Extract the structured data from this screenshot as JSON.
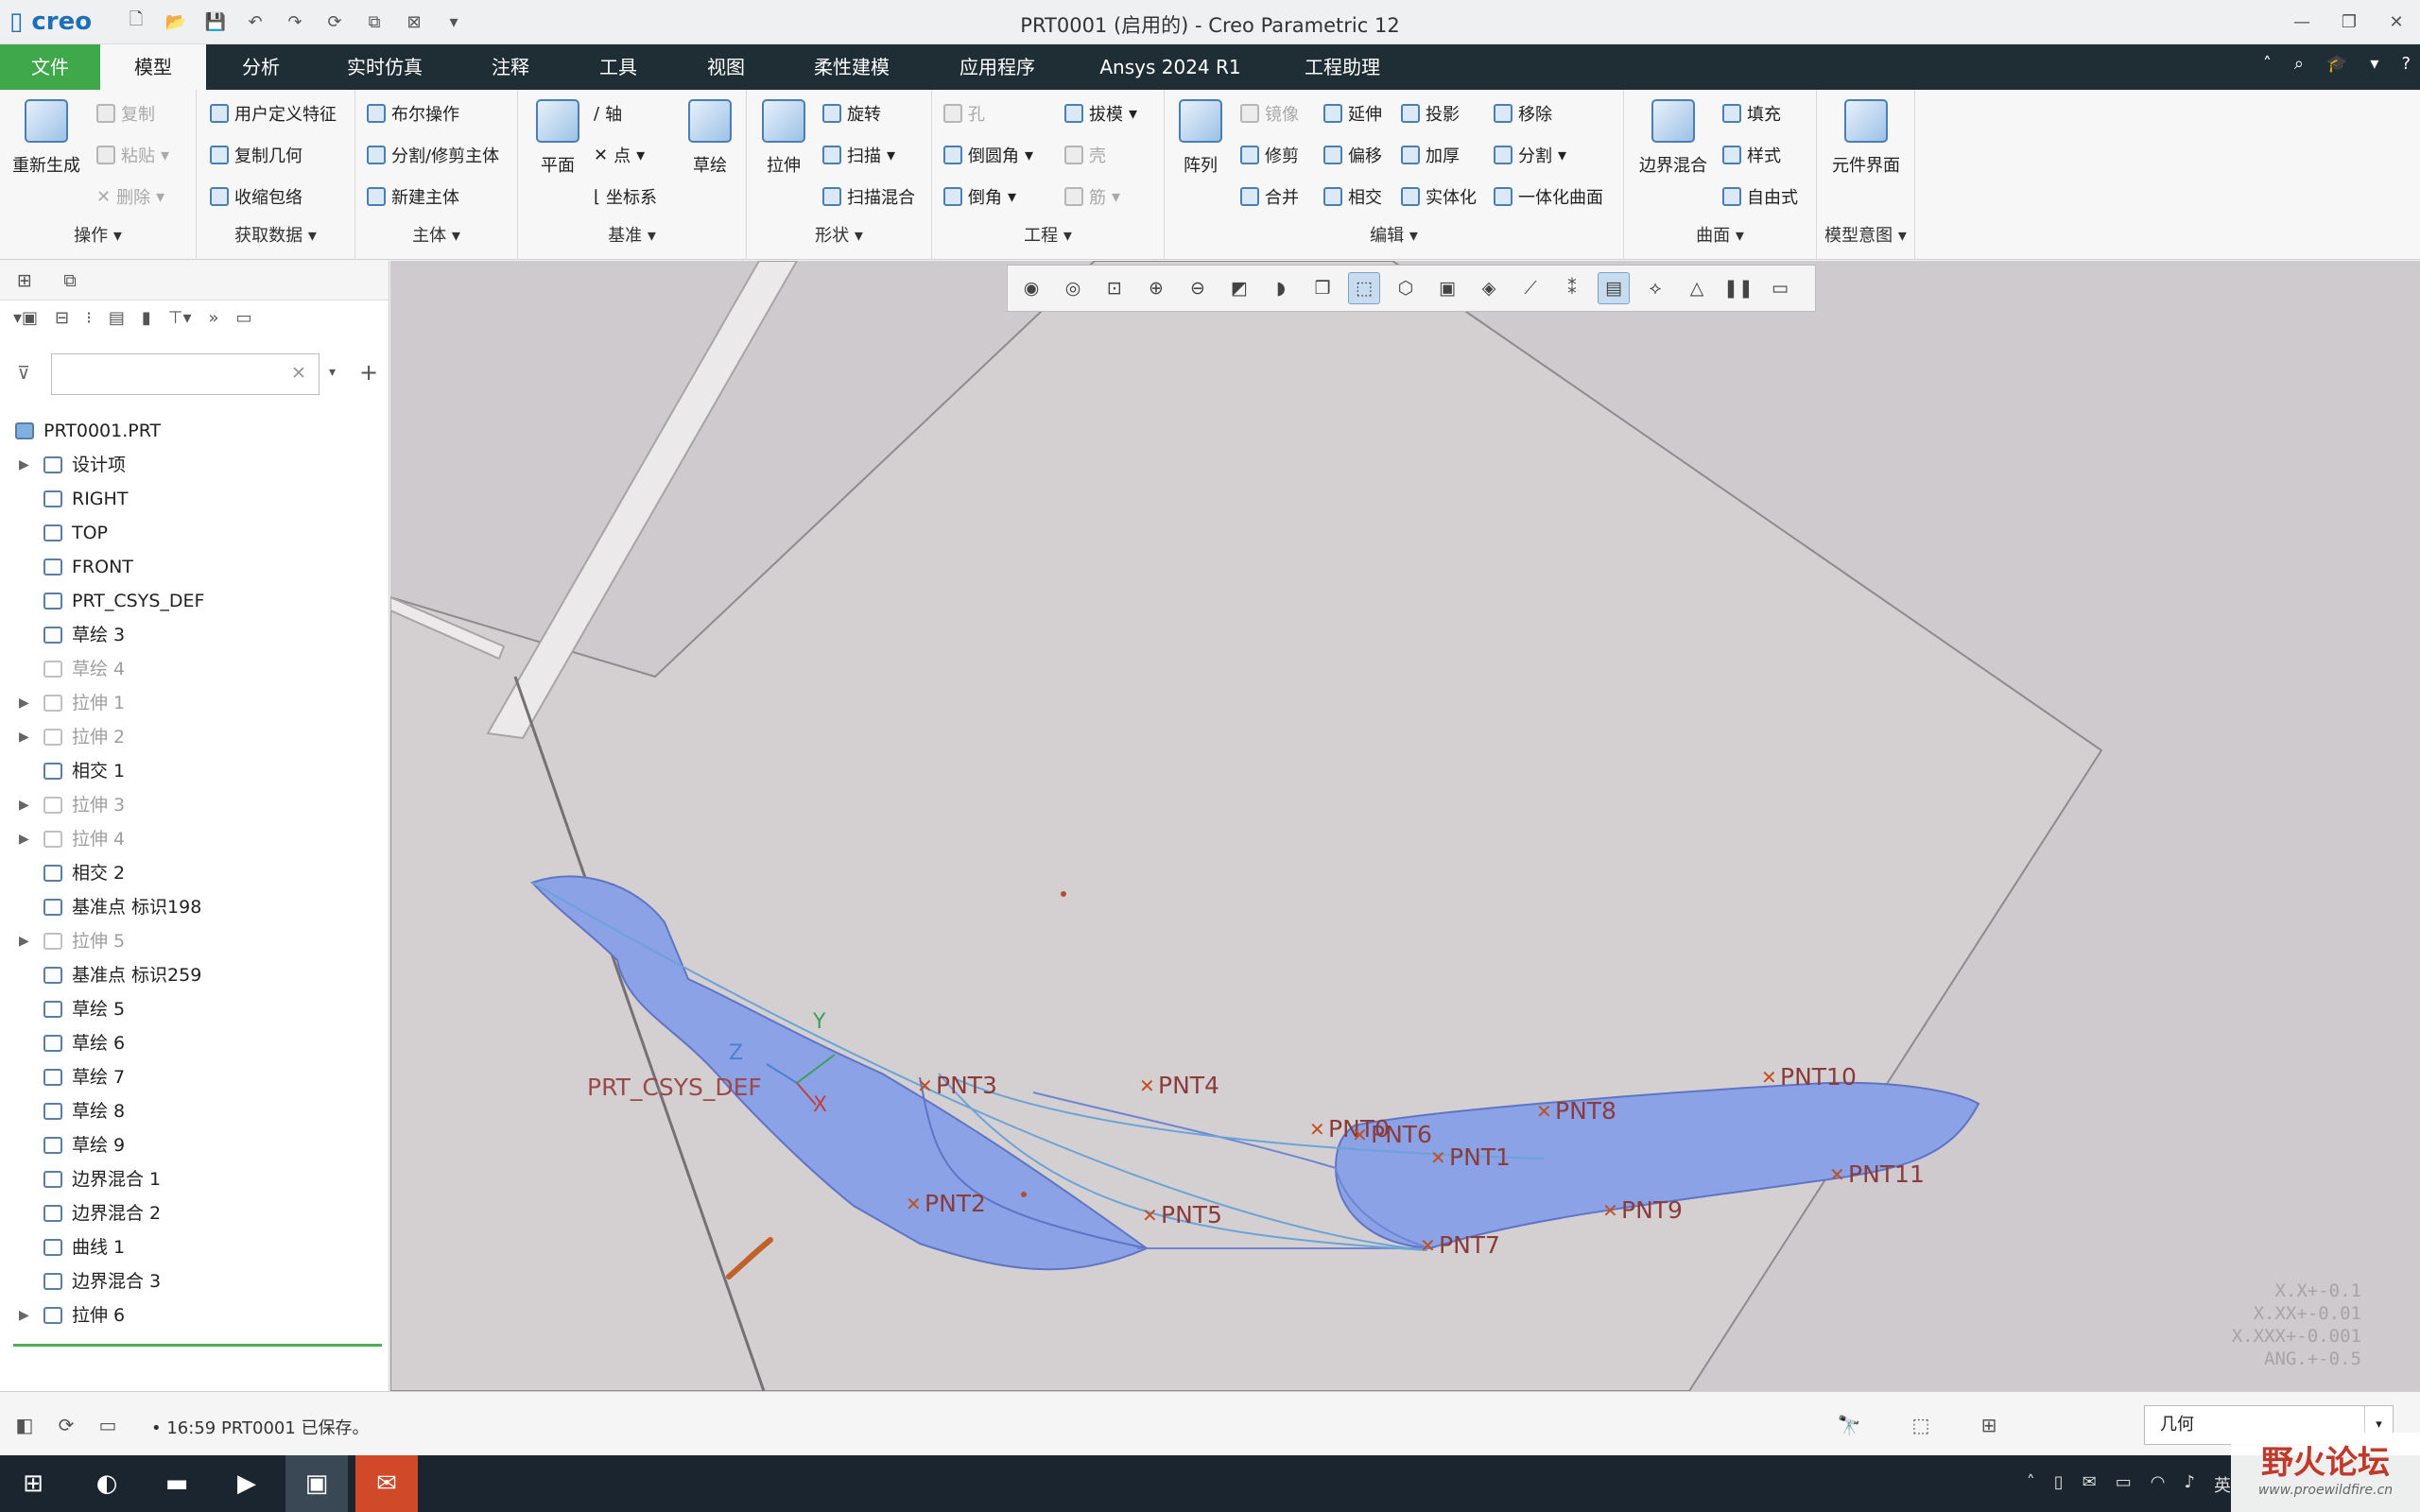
{
  "window": {
    "logo": "creo",
    "title": "PRT0001 (启用的) - Creo Parametric 12"
  },
  "tabs": [
    {
      "label": "文件"
    },
    {
      "label": "模型"
    },
    {
      "label": "分析"
    },
    {
      "label": "实时仿真"
    },
    {
      "label": "注释"
    },
    {
      "label": "工具"
    },
    {
      "label": "视图"
    },
    {
      "label": "柔性建模"
    },
    {
      "label": "应用程序"
    },
    {
      "label": "Ansys 2024 R1"
    },
    {
      "label": "工程助理"
    }
  ],
  "ribbon": {
    "ops": {
      "regen": "重新生成",
      "copy": "复制",
      "paste": "粘贴",
      "delete": "删除",
      "label": "操作"
    },
    "getdata": {
      "udf": "用户定义特征",
      "copygeom": "复制几何",
      "shrinkwrap": "收缩包络",
      "label": "获取数据"
    },
    "body": {
      "boolean": "布尔操作",
      "split": "分割/修剪主体",
      "newbody": "新建主体",
      "label": "主体"
    },
    "datum": {
      "plane": "平面",
      "axis": "轴",
      "point": "点",
      "csys": "坐标系",
      "sketch": "草绘",
      "label": "基准"
    },
    "shapes": {
      "extrude": "拉伸",
      "revolve": "旋转",
      "sweep": "扫描",
      "sweptblend": "扫描混合",
      "label": "形状"
    },
    "eng": {
      "hole": "孔",
      "draft": "拔模",
      "round": "倒圆角",
      "shell": "壳",
      "chamfer": "倒角",
      "rib": "筋",
      "label": "工程"
    },
    "edit": {
      "pattern": "阵列",
      "mirror": "镜像",
      "extend": "延伸",
      "project": "投影",
      "move": "移除",
      "trim": "修剪",
      "offset": "偏移",
      "thicken": "加厚",
      "split": "分割",
      "merge": "合并",
      "intersect": "相交",
      "solidify": "实体化",
      "unify": "一体化曲面",
      "label": "编辑"
    },
    "surfaces": {
      "boundary": "边界混合",
      "fill": "填充",
      "style": "样式",
      "freestyle": "自由式",
      "label": "曲面"
    },
    "intent": {
      "compinterface": "元件界面",
      "label": "模型意图"
    }
  },
  "tree": {
    "items": [
      {
        "label": "PRT0001.PRT",
        "expandable": false,
        "suppressed": false
      },
      {
        "label": "设计项",
        "expandable": true,
        "suppressed": false
      },
      {
        "label": "RIGHT",
        "expandable": false,
        "suppressed": false
      },
      {
        "label": "TOP",
        "expandable": false,
        "suppressed": false
      },
      {
        "label": "FRONT",
        "expandable": false,
        "suppressed": false
      },
      {
        "label": "PRT_CSYS_DEF",
        "expandable": false,
        "suppressed": false
      },
      {
        "label": "草绘 3",
        "expandable": false,
        "suppressed": false
      },
      {
        "label": "草绘 4",
        "expandable": false,
        "suppressed": true
      },
      {
        "label": "拉伸 1",
        "expandable": true,
        "suppressed": true
      },
      {
        "label": "拉伸 2",
        "expandable": true,
        "suppressed": true
      },
      {
        "label": "相交 1",
        "expandable": false,
        "suppressed": false
      },
      {
        "label": "拉伸 3",
        "expandable": true,
        "suppressed": true
      },
      {
        "label": "拉伸 4",
        "expandable": true,
        "suppressed": true
      },
      {
        "label": "相交 2",
        "expandable": false,
        "suppressed": false
      },
      {
        "label": "基准点 标识198",
        "expandable": false,
        "suppressed": false
      },
      {
        "label": "拉伸 5",
        "expandable": true,
        "suppressed": true
      },
      {
        "label": "基准点 标识259",
        "expandable": false,
        "suppressed": false
      },
      {
        "label": "草绘 5",
        "expandable": false,
        "suppressed": false
      },
      {
        "label": "草绘 6",
        "expandable": false,
        "suppressed": false
      },
      {
        "label": "草绘 7",
        "expandable": false,
        "suppressed": false
      },
      {
        "label": "草绘 8",
        "expandable": false,
        "suppressed": false
      },
      {
        "label": "草绘 9",
        "expandable": false,
        "suppressed": false
      },
      {
        "label": "边界混合 1",
        "expandable": false,
        "suppressed": false
      },
      {
        "label": "边界混合 2",
        "expandable": false,
        "suppressed": false
      },
      {
        "label": "曲线 1",
        "expandable": false,
        "suppressed": false
      },
      {
        "label": "边界混合 3",
        "expandable": false,
        "suppressed": false
      },
      {
        "label": "拉伸 6",
        "expandable": true,
        "suppressed": false
      }
    ]
  },
  "viewport": {
    "csys_label": "PRT_CSYS_DEF",
    "axis_z": "Z",
    "axis_y": "Y",
    "axis_x": "X",
    "points": [
      "PNT2",
      "PNT3",
      "PNT4",
      "PNT5",
      "PNT0",
      "PNT6",
      "PNT1",
      "PNT7",
      "PNT8",
      "PNT9",
      "PNT10",
      "PNT11"
    ],
    "tolerances": [
      "X.X+-0.1",
      "X.XX+-0.01",
      "X.XXX+-0.001",
      "ANG.+-0.5"
    ]
  },
  "status": {
    "message": "16:59 PRT0001 已保存。",
    "filter_value": "几何"
  },
  "taskbar": {
    "tray_lang": "英",
    "watermark_main": "野火论坛",
    "watermark_url": "www.proewildfire.cn"
  }
}
